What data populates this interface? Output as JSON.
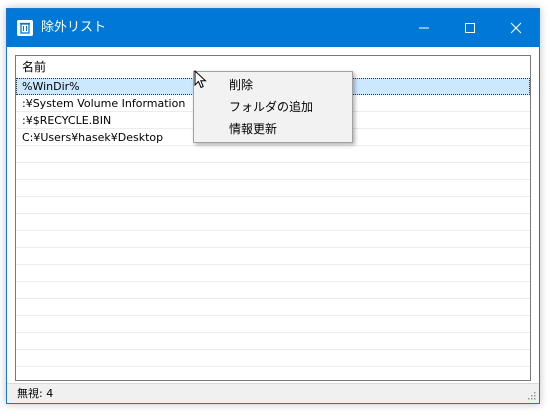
{
  "window": {
    "title": "除外リスト",
    "title_icon": "recycle-bin-icon",
    "controls": {
      "minimize": "minimize-icon",
      "maximize": "maximize-icon",
      "close": "close-icon"
    },
    "accent_color": "#0078d7"
  },
  "list": {
    "column_header": "名前",
    "rows": [
      {
        "name": "%WinDir%",
        "selected": true
      },
      {
        "name": ":¥System Volume Information",
        "selected": false
      },
      {
        "name": ":¥$RECYCLE.BIN",
        "selected": false
      },
      {
        "name": "C:¥Users¥hasek¥Desktop",
        "selected": false
      }
    ],
    "selection_color": "#cce8ff"
  },
  "context_menu": {
    "items": [
      {
        "label": "削除"
      },
      {
        "label": "フォルダの追加"
      },
      {
        "label": "情報更新"
      }
    ]
  },
  "statusbar": {
    "text": "無視: 4"
  }
}
